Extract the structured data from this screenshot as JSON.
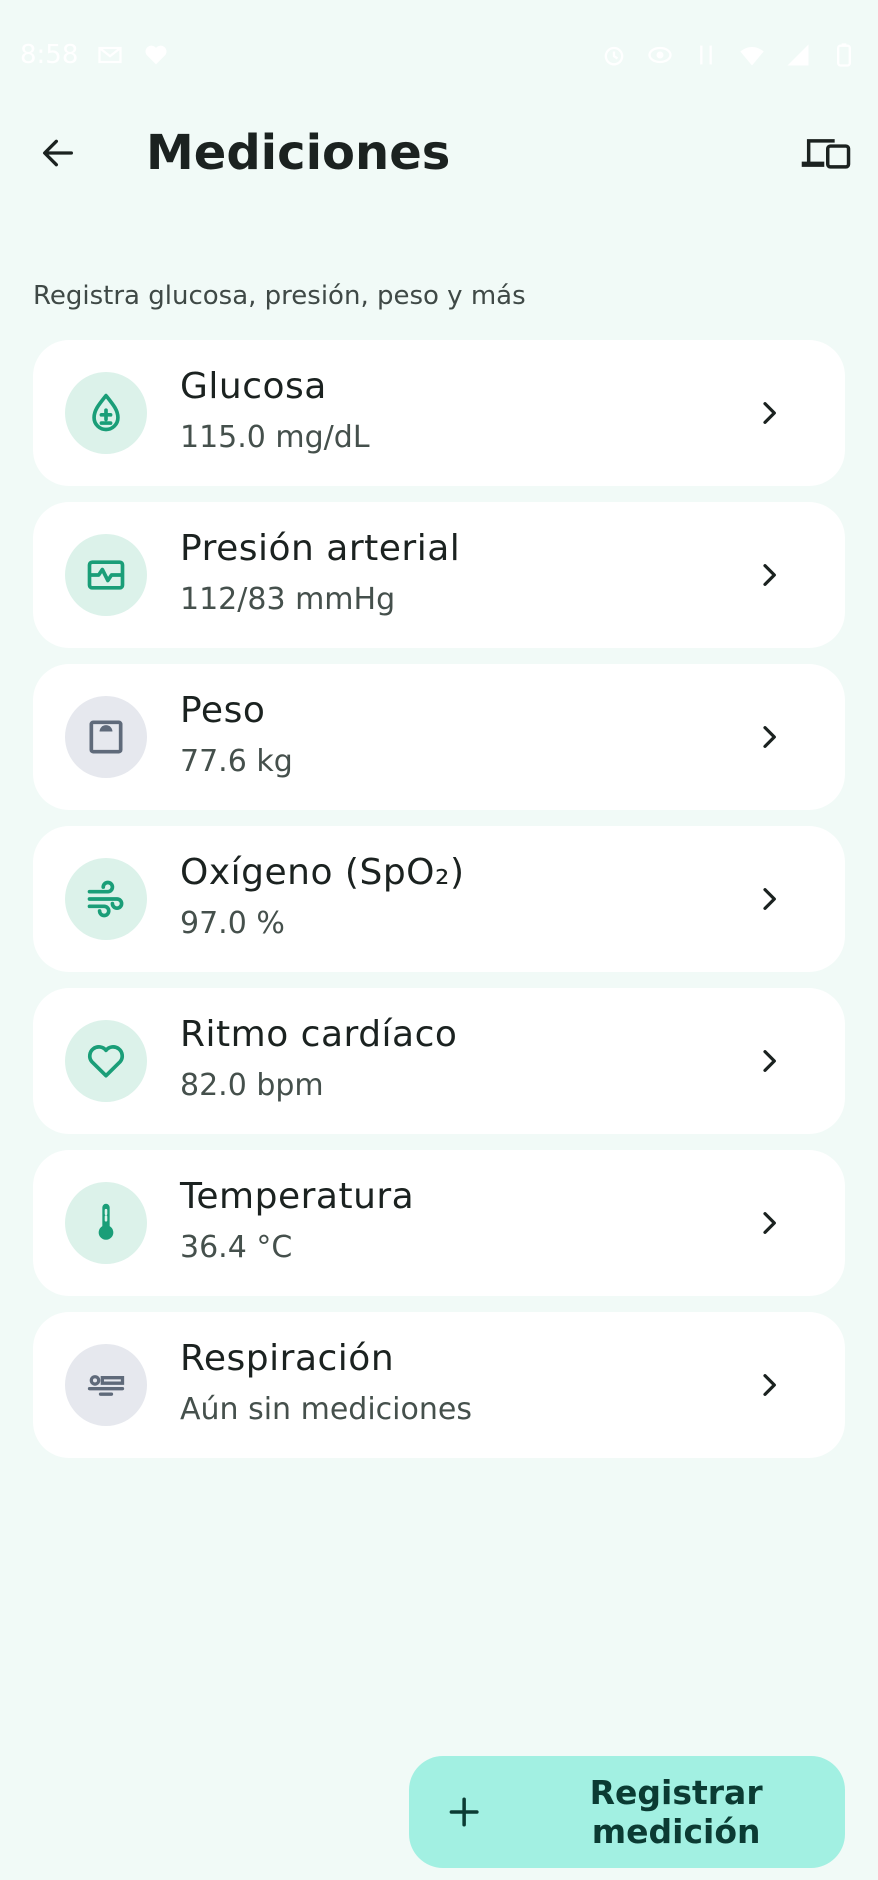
{
  "status_bar": {
    "time": "8:58"
  },
  "header": {
    "title": "Mediciones"
  },
  "subtitle": "Registra glucosa, presión, peso y más",
  "measurements": [
    {
      "title": "Glucosa",
      "value": "115.0 mg/dL",
      "icon": "glucose-drop-icon",
      "tone": "green"
    },
    {
      "title": "Presión arterial",
      "value": "112/83 mmHg",
      "icon": "blood-pressure-icon",
      "tone": "green"
    },
    {
      "title": "Peso",
      "value": "77.6 kg",
      "icon": "scale-icon",
      "tone": "gray"
    },
    {
      "title": "Oxígeno (SpO₂)",
      "value": "97.0 %",
      "icon": "air-wind-icon",
      "tone": "green"
    },
    {
      "title": "Ritmo cardíaco",
      "value": "82.0 bpm",
      "icon": "heart-icon",
      "tone": "green"
    },
    {
      "title": "Temperatura",
      "value": "36.4 °C",
      "icon": "thermometer-icon",
      "tone": "green"
    },
    {
      "title": "Respiración",
      "value": "Aún sin mediciones",
      "icon": "bed-sleep-icon",
      "tone": "gray"
    }
  ],
  "fab": {
    "label": "Registrar medición"
  },
  "colors": {
    "background": "#f1faf7",
    "accent": "#1a9e78",
    "fab": "#a2f0e2",
    "icon_gray": "#5f6a7a"
  }
}
